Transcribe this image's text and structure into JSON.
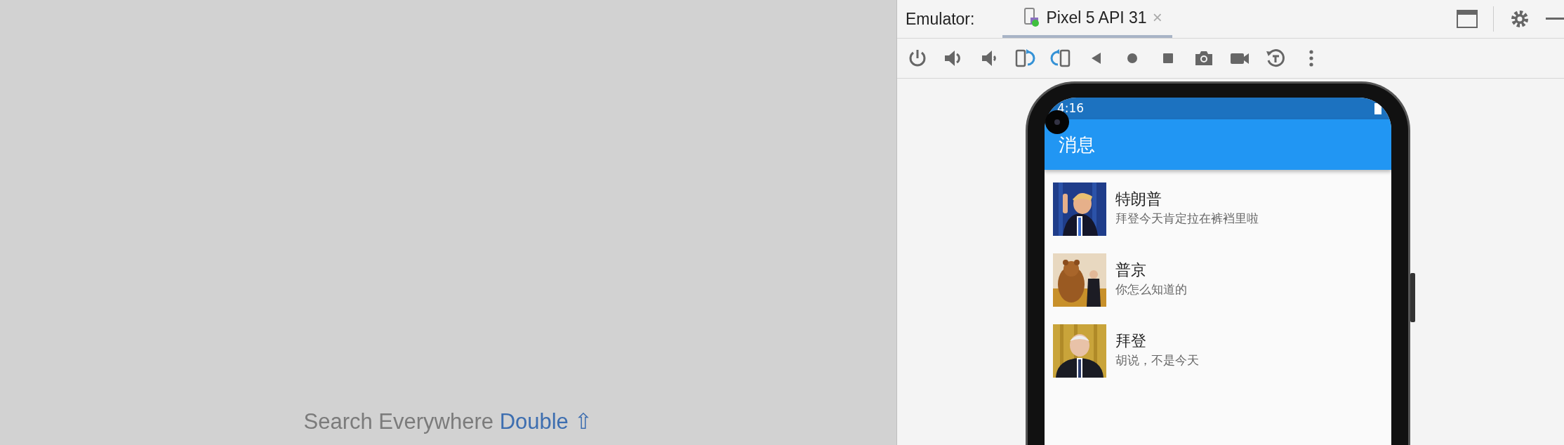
{
  "search_hint": {
    "text": "Search Everywhere",
    "shortcut": "Double",
    "key": "⇧"
  },
  "emulator": {
    "label": "Emulator:",
    "tabs": [
      {
        "label": "Pixel 5 API 31",
        "selected": true,
        "close": "×"
      }
    ],
    "device": {
      "status_bar": {
        "time": "4:16"
      },
      "app_bar": {
        "title": "消息"
      },
      "messages": [
        {
          "name": "特朗普",
          "text": "拜登今天肯定拉在裤裆里啦"
        },
        {
          "name": "普京",
          "text": "你怎么知道的"
        },
        {
          "name": "拜登",
          "text": "胡说，不是今天"
        }
      ]
    }
  }
}
